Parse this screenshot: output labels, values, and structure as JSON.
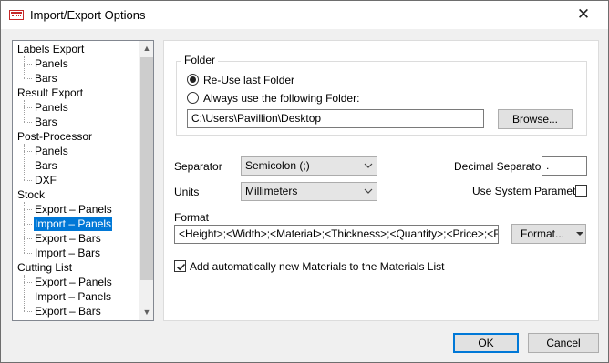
{
  "window": {
    "title": "Import/Export Options",
    "close_glyph": "✕",
    "icon": "app-table-icon"
  },
  "tree": {
    "items": [
      {
        "label": "Labels Export",
        "level": 0,
        "selected": false
      },
      {
        "label": "Panels",
        "level": 1,
        "selected": false
      },
      {
        "label": "Bars",
        "level": 1,
        "selected": false
      },
      {
        "label": "Result Export",
        "level": 0,
        "selected": false
      },
      {
        "label": "Panels",
        "level": 1,
        "selected": false
      },
      {
        "label": "Bars",
        "level": 1,
        "selected": false
      },
      {
        "label": "Post-Processor",
        "level": 0,
        "selected": false
      },
      {
        "label": "Panels",
        "level": 1,
        "selected": false
      },
      {
        "label": "Bars",
        "level": 1,
        "selected": false
      },
      {
        "label": "DXF",
        "level": 1,
        "selected": false
      },
      {
        "label": "Stock",
        "level": 0,
        "selected": false
      },
      {
        "label": "Export – Panels",
        "level": 1,
        "selected": false
      },
      {
        "label": "Import – Panels",
        "level": 1,
        "selected": true
      },
      {
        "label": "Export – Bars",
        "level": 1,
        "selected": false
      },
      {
        "label": "Import – Bars",
        "level": 1,
        "selected": false
      },
      {
        "label": "Cutting List",
        "level": 0,
        "selected": false
      },
      {
        "label": "Export – Panels",
        "level": 1,
        "selected": false
      },
      {
        "label": "Import – Panels",
        "level": 1,
        "selected": false
      },
      {
        "label": "Export – Bars",
        "level": 1,
        "selected": false
      }
    ]
  },
  "folder": {
    "group_label": "Folder",
    "reuse_label": "Re-Use last Folder",
    "always_label": "Always use the following Folder:",
    "path_value": "C:\\Users\\Pavillion\\Desktop",
    "browse_label": "Browse..."
  },
  "separator": {
    "label": "Separator",
    "value": "Semicolon (;)"
  },
  "units": {
    "label": "Units",
    "value": "Millimeters"
  },
  "decimal": {
    "label": "Decimal Separator",
    "value": "."
  },
  "system_param": {
    "label": "Use System Parameter",
    "checked": false
  },
  "format": {
    "label": "Format",
    "value": "<Height>;<Width>;<Material>;<Thickness>;<Quantity>;<Price>;<Re",
    "button_label": "Format..."
  },
  "add_materials": {
    "label": "Add automatically new Materials to the Materials List",
    "checked": true
  },
  "footer": {
    "ok_label": "OK",
    "cancel_label": "Cancel"
  },
  "colors": {
    "selection": "#0078d7",
    "accent_border": "#0078d7",
    "background": "#f0f0f0"
  }
}
